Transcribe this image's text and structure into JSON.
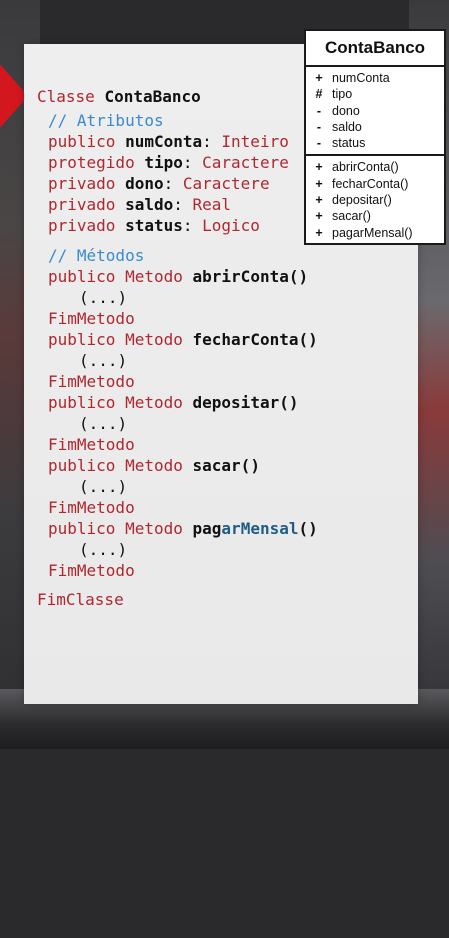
{
  "code": {
    "class_keyword": "Classe",
    "class_name": "ContaBanco",
    "comment_attrs": "// Atributos",
    "attributes": [
      {
        "visibility": "publico",
        "name": "numConta",
        "type": "Inteiro"
      },
      {
        "visibility": "protegido",
        "name": "tipo",
        "type": "Caractere"
      },
      {
        "visibility": "privado",
        "name": "dono",
        "type": "Caractere"
      },
      {
        "visibility": "privado",
        "name": "saldo",
        "type": "Real"
      },
      {
        "visibility": "privado",
        "name": "status",
        "type": "Logico"
      }
    ],
    "comment_methods": "// Métodos",
    "method_keyword": "Metodo",
    "ellipsis": "(...)",
    "end_method": "FimMetodo",
    "methods": [
      {
        "visibility": "publico",
        "name": "abrirConta()"
      },
      {
        "visibility": "publico",
        "name": "fecharConta()"
      },
      {
        "visibility": "publico",
        "name": "depositar()"
      },
      {
        "visibility": "publico",
        "name": "sacar()"
      },
      {
        "visibility": "publico",
        "name_a": "pag",
        "name_b": "arMensal",
        "name_c": "()"
      }
    ],
    "end_class": "FimClasse"
  },
  "uml": {
    "title": "ContaBanco",
    "attributes": [
      {
        "vis": "+",
        "name": "numConta"
      },
      {
        "vis": "#",
        "name": "tipo"
      },
      {
        "vis": "-",
        "name": "dono"
      },
      {
        "vis": "-",
        "name": "saldo"
      },
      {
        "vis": "-",
        "name": "status"
      }
    ],
    "methods": [
      {
        "vis": "+",
        "name": "abrirConta()"
      },
      {
        "vis": "+",
        "name": "fecharConta()"
      },
      {
        "vis": "+",
        "name": "depositar()"
      },
      {
        "vis": "+",
        "name": "sacar()"
      },
      {
        "vis": "+",
        "name": "pagarMensal()"
      }
    ]
  },
  "colors": {
    "keyword": "#b0272f",
    "comment": "#3a8ad0",
    "accent_arrow": "#d4161f"
  }
}
